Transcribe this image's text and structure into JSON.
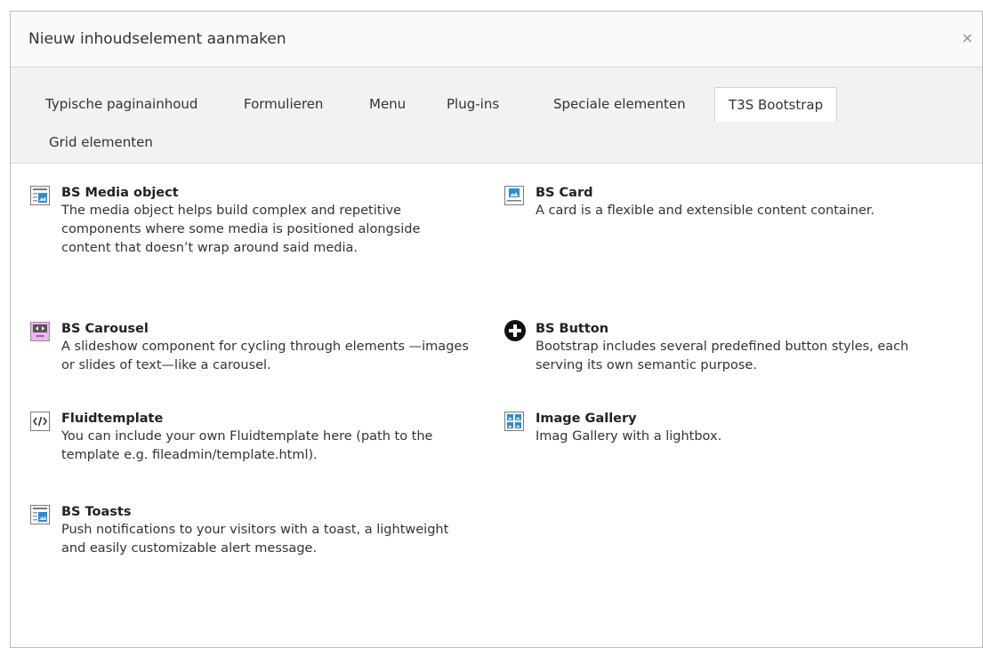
{
  "modal": {
    "title": "Nieuw inhoudselement aanmaken",
    "close_label": "×"
  },
  "tabs": [
    {
      "label": "Typische paginainhoud"
    },
    {
      "label": "Formulieren"
    },
    {
      "label": "Menu"
    },
    {
      "label": "Plug-ins"
    },
    {
      "label": "Speciale elementen"
    },
    {
      "label": "T3S Bootstrap",
      "active": true
    },
    {
      "label": "Grid elementen"
    }
  ],
  "items": [
    {
      "icon": "media-object-icon",
      "title": "BS Media object",
      "desc": "The media object helps build complex and repetitive components where some media is positioned alongside content that doesn’t wrap around said media."
    },
    {
      "icon": "card-icon",
      "title": "BS Card",
      "desc": "A card is a flexible and extensible content container."
    },
    {
      "icon": "carousel-icon",
      "title": "BS Carousel",
      "desc": "A slideshow component for cycling through elements —images or slides of text—like a carousel."
    },
    {
      "icon": "button-plus-icon",
      "title": "BS Button",
      "desc": "Bootstrap includes several predefined button styles, each serving its own semantic purpose."
    },
    {
      "icon": "code-icon",
      "title": "Fluidtemplate",
      "desc": "You can include your own Fluidtemplate here (path to the template e.g. fileadmin/template.html)."
    },
    {
      "icon": "image-gallery-icon",
      "title": "Image Gallery",
      "desc": "Imag Gallery with a lightbox."
    },
    {
      "icon": "toasts-icon",
      "title": "BS Toasts",
      "desc": "Push notifications to your visitors with a toast, a lightweight and easily customizable alert message."
    }
  ]
}
